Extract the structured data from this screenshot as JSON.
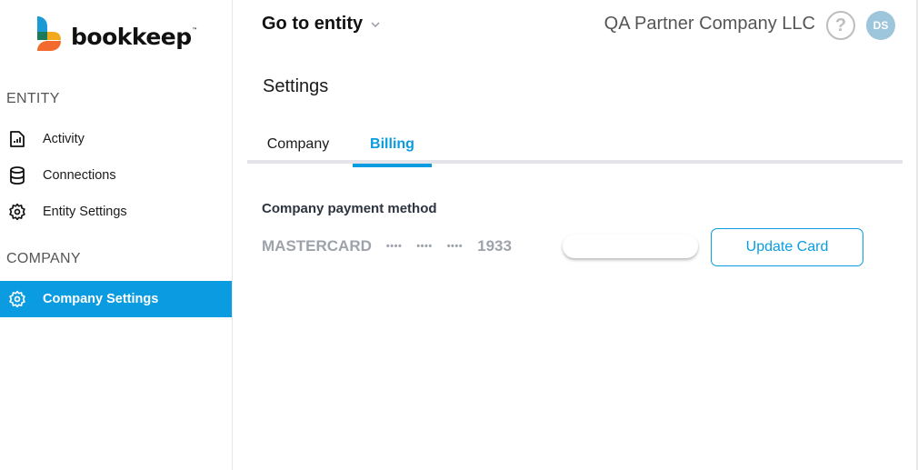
{
  "brand": {
    "name": "bookkeep",
    "trademark": "™",
    "colors": {
      "blue": "#1c9ad6",
      "green": "#1a7a5a",
      "yellow": "#f2a91c",
      "orange": "#f26a2e"
    }
  },
  "sidebar": {
    "sections": [
      {
        "label": "ENTITY",
        "items": [
          {
            "label": "Activity",
            "icon": "activity-report-icon",
            "active": false
          },
          {
            "label": "Connections",
            "icon": "database-icon",
            "active": false
          },
          {
            "label": "Entity Settings",
            "icon": "gear-icon",
            "active": false
          }
        ]
      },
      {
        "label": "COMPANY",
        "items": [
          {
            "label": "Company Settings",
            "icon": "gear-icon",
            "active": true
          }
        ]
      }
    ]
  },
  "header": {
    "entity_selector": "Go to entity",
    "company_name": "QA Partner Company LLC",
    "help_glyph": "?",
    "avatar_initials": "DS"
  },
  "page": {
    "title": "Settings",
    "tabs": [
      {
        "label": "Company",
        "active": false
      },
      {
        "label": "Billing",
        "active": true
      }
    ]
  },
  "billing": {
    "heading": "Company payment method",
    "card_brand": "MASTERCARD",
    "masked_groups": [
      "••••",
      "••••",
      "••••"
    ],
    "last4": "1933",
    "card_input_value": "",
    "update_button": "Update Card"
  },
  "colors": {
    "accent": "#0a9be0",
    "muted_text": "#9ea3ab",
    "avatar_bg": "#9dc5dc"
  }
}
